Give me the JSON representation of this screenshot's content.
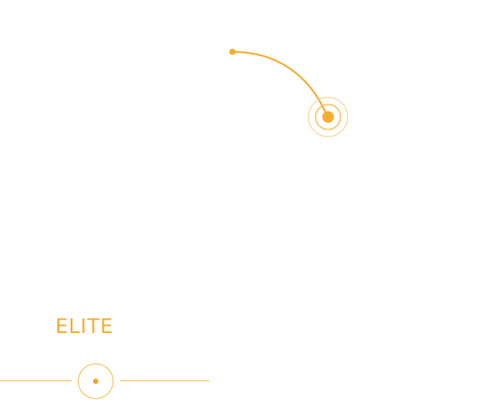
{
  "slide": {
    "label": "ELITE"
  },
  "icons": {
    "arc": "curved-path-icon",
    "target": "target-icon",
    "bottom_target": "radio-target-icon"
  },
  "colors": {
    "accent": "#F5AE32",
    "line": "#F1C75F"
  }
}
